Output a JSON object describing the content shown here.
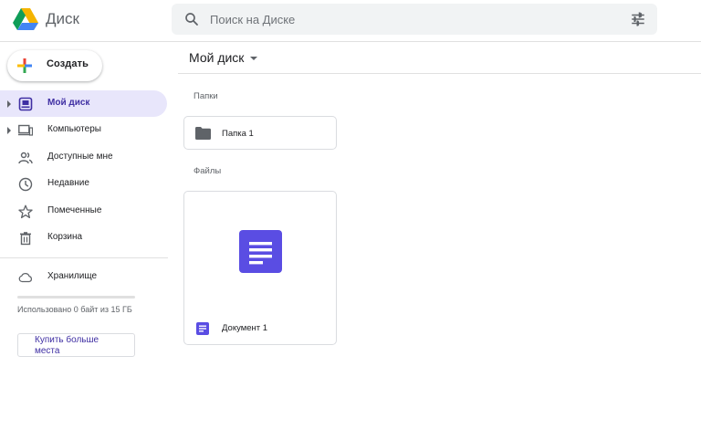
{
  "header": {
    "app_title": "Диск",
    "search_placeholder": "Поиск на Диске",
    "icons": [
      "drive-logo-icon",
      "search-icon",
      "tune-icon"
    ]
  },
  "sidebar": {
    "new_button_label": "Создать",
    "items": [
      {
        "label": "Мой диск",
        "icon": "my-drive-icon",
        "active": true,
        "expandable": true
      },
      {
        "label": "Компьютеры",
        "icon": "computers-icon",
        "active": false,
        "expandable": true
      },
      {
        "label": "Доступные мне",
        "icon": "shared-people-icon",
        "active": false,
        "expandable": false
      },
      {
        "label": "Недавние",
        "icon": "clock-icon",
        "active": false,
        "expandable": false
      },
      {
        "label": "Помеченные",
        "icon": "star-icon",
        "active": false,
        "expandable": false
      },
      {
        "label": "Корзина",
        "icon": "trash-icon",
        "active": false,
        "expandable": false
      }
    ],
    "storage": {
      "label": "Хранилище",
      "icon": "cloud-icon",
      "used_text": "Использовано 0 байт из 15 ГБ",
      "used_fraction": 0,
      "buy_label": "Купить больше места"
    }
  },
  "main": {
    "location": "Мой диск",
    "folders_title": "Папки",
    "files_title": "Файлы",
    "folders": [
      {
        "name": "Папка 1",
        "icon": "folder-icon"
      }
    ],
    "files": [
      {
        "name": "Документ 1",
        "icon": "docs-icon"
      }
    ]
  },
  "colors": {
    "accent": "#4b3fd9",
    "active_bg": "#e8e6fb",
    "active_text": "#3f2fa3",
    "search_bg": "#f1f3f4",
    "doc_icon": "#5a4de3"
  }
}
